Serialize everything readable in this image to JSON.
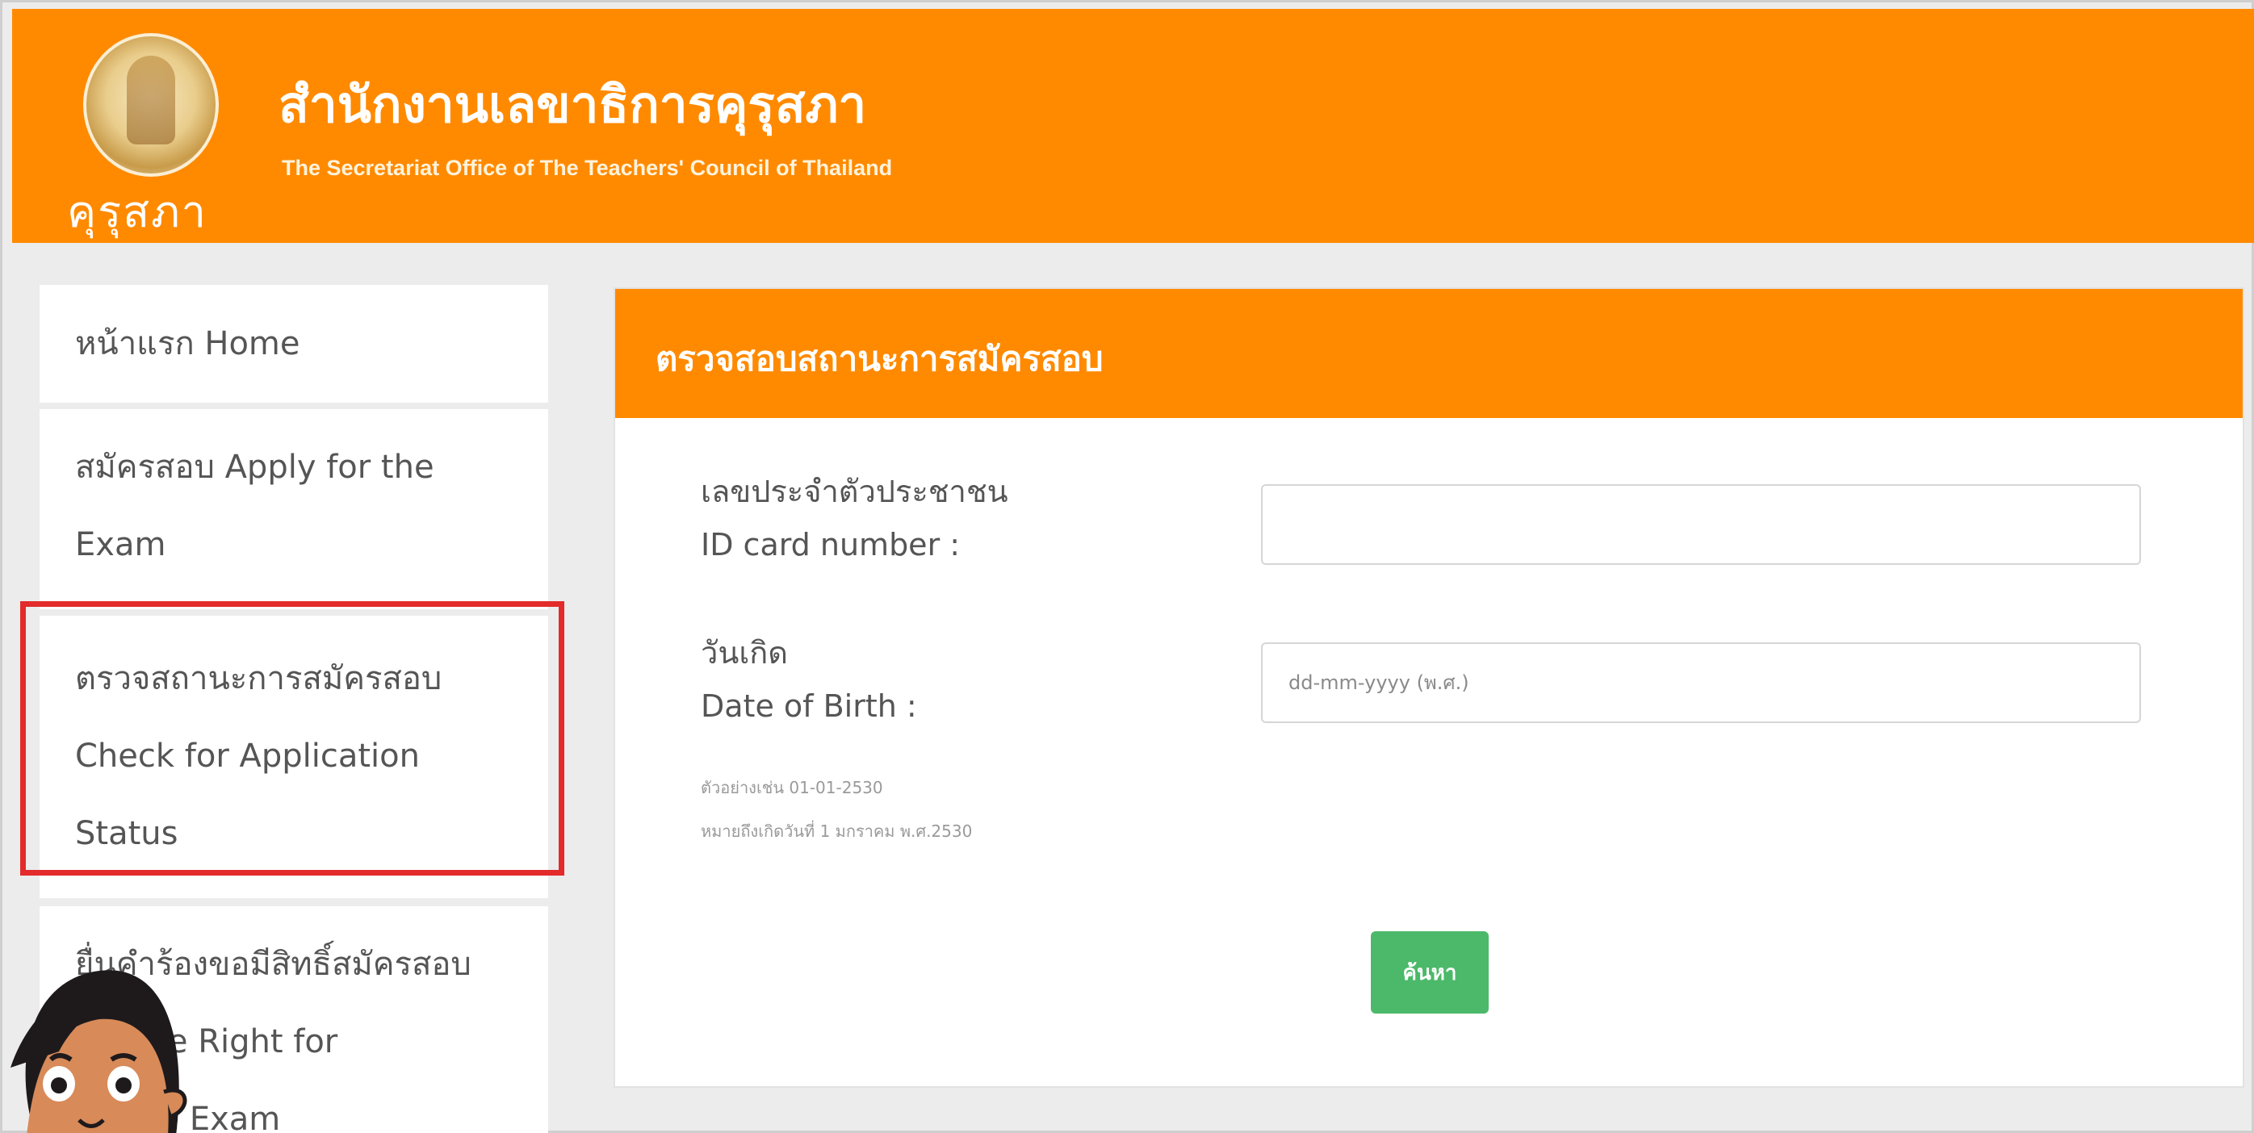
{
  "header": {
    "logo_text": "คุรุสภา",
    "title_th": "สำนักงานเลขาธิการคุรุสภา",
    "title_en": "The Secretariat Office of The Teachers' Council of Thailand",
    "accent_color": "#ff8a00"
  },
  "sidebar": {
    "items": [
      {
        "lines": [
          "หน้าแรก Home"
        ]
      },
      {
        "lines": [
          "สมัครสอบ Apply for the",
          "Exam"
        ]
      },
      {
        "lines": [
          "ตรวจสถานะการสมัครสอบ",
          "Check for Application",
          "Status"
        ]
      },
      {
        "lines": [
          "ยื่นคำร้องขอมีสิทธิ์สมัครสอบ",
          "est the Right for",
          "ng the Exam"
        ]
      }
    ],
    "highlight_color": "#e32b2b"
  },
  "main": {
    "panel_title": "ตรวจสอบสถานะการสมัครสอบ",
    "id_field": {
      "label_th": "เลขประจำตัวประชาชน",
      "label_en": "ID card number :",
      "value": "",
      "placeholder": ""
    },
    "dob_field": {
      "label_th": "วันเกิด",
      "label_en": "Date of Birth :",
      "value": "",
      "placeholder": "dd-mm-yyyy (พ.ศ.)",
      "hint_example": "ตัวอย่างเช่น 01-01-2530",
      "hint_meaning": "หมายถึงเกิดวันที่ 1 มกราคม พ.ศ.2530"
    },
    "search_button": "ค้นหา",
    "button_color": "#4cb96a"
  }
}
